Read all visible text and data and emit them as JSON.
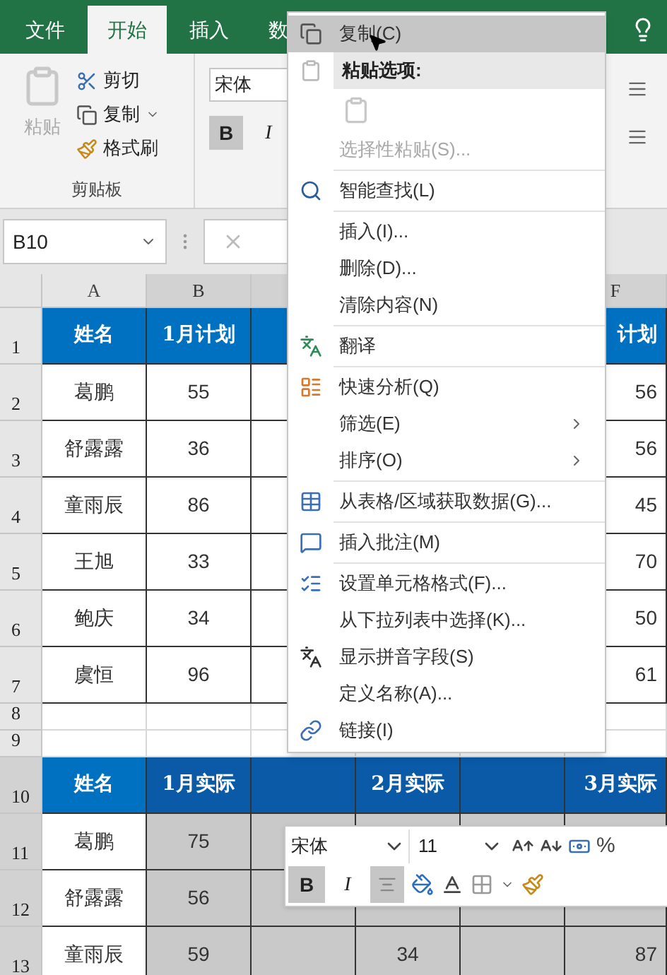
{
  "ribbon_tabs": [
    {
      "label": "文件",
      "selected": false
    },
    {
      "label": "开始",
      "selected": true
    },
    {
      "label": "插入",
      "selected": false
    },
    {
      "label": "数",
      "selected": false
    }
  ],
  "clipboard": {
    "paste": {
      "label": "粘贴",
      "disabled": true
    },
    "actions": [
      {
        "label": "剪切",
        "dropdown": false
      },
      {
        "label": "复制",
        "dropdown": true
      },
      {
        "label": "格式刷",
        "dropdown": false
      }
    ],
    "group_label": "剪贴板"
  },
  "font": {
    "name": "宋体",
    "bold_label": "B",
    "italic_label": "I",
    "bold_pressed": true,
    "italic_pressed": false
  },
  "name_box": "B10",
  "columns": [
    {
      "label": "A",
      "selected": false
    },
    {
      "label": "B",
      "selected": true
    },
    {
      "selected": true
    },
    null,
    null,
    {
      "label": "F",
      "selected": true
    }
  ],
  "rows": [
    {
      "label": "1",
      "kind": "header",
      "selected": false,
      "cells": [
        "姓名",
        "1月计划",
        null,
        null,
        null,
        "计划"
      ]
    },
    {
      "label": "2",
      "kind": "data",
      "selected": false,
      "cells": [
        "葛鹏",
        "55",
        null,
        null,
        null,
        "56"
      ]
    },
    {
      "label": "3",
      "kind": "data",
      "selected": false,
      "cells": [
        "舒露露",
        "36",
        null,
        null,
        null,
        "56"
      ]
    },
    {
      "label": "4",
      "kind": "data",
      "selected": false,
      "cells": [
        "童雨辰",
        "86",
        null,
        null,
        null,
        "45"
      ]
    },
    {
      "label": "5",
      "kind": "data",
      "selected": false,
      "cells": [
        "王旭",
        "33",
        null,
        null,
        null,
        "70"
      ]
    },
    {
      "label": "6",
      "kind": "data",
      "selected": false,
      "cells": [
        "鲍庆",
        "34",
        null,
        null,
        null,
        "50"
      ]
    },
    {
      "label": "7",
      "kind": "data",
      "selected": false,
      "cells": [
        "虞恒",
        "96",
        null,
        null,
        null,
        "61"
      ]
    },
    {
      "label": "8",
      "kind": "empty",
      "selected": false,
      "cells": [
        null,
        null,
        null,
        null,
        null,
        null
      ]
    },
    {
      "label": "9",
      "kind": "empty",
      "selected": false,
      "cells": [
        null,
        null,
        null,
        null,
        null,
        null
      ]
    },
    {
      "label": "10",
      "kind": "header",
      "selected": true,
      "cells": [
        "姓名",
        "1月实际",
        null,
        "2月实际",
        null,
        "3月实际"
      ]
    },
    {
      "label": "11",
      "kind": "data",
      "selected": true,
      "cells": [
        "葛鹏",
        "75",
        null,
        null,
        null,
        null
      ]
    },
    {
      "label": "12",
      "kind": "data",
      "selected": true,
      "cells": [
        "舒露露",
        "56",
        null,
        null,
        null,
        null
      ]
    },
    {
      "label": "13",
      "kind": "data",
      "selected": true,
      "cells": [
        "童雨辰",
        "59",
        null,
        "34",
        null,
        "87"
      ]
    }
  ],
  "context_menu": {
    "items": [
      {
        "kind": "item",
        "label": "复制(C)",
        "highlighted": true,
        "disabled": false,
        "submenu": false
      },
      {
        "kind": "header",
        "label": "粘贴选项:"
      },
      {
        "kind": "paste-option",
        "disabled": true
      },
      {
        "kind": "item",
        "label": "选择性粘贴(S)...",
        "highlighted": false,
        "disabled": true,
        "submenu": false
      },
      {
        "kind": "separator"
      },
      {
        "kind": "item",
        "label": "智能查找(L)",
        "highlighted": false,
        "disabled": false,
        "submenu": false
      },
      {
        "kind": "separator"
      },
      {
        "kind": "item",
        "label": "插入(I)...",
        "highlighted": false,
        "disabled": false,
        "submenu": false
      },
      {
        "kind": "item",
        "label": "删除(D)...",
        "highlighted": false,
        "disabled": false,
        "submenu": false
      },
      {
        "kind": "item",
        "label": "清除内容(N)",
        "highlighted": false,
        "disabled": false,
        "submenu": false
      },
      {
        "kind": "separator"
      },
      {
        "kind": "item",
        "label": "翻译",
        "highlighted": false,
        "disabled": false,
        "submenu": false
      },
      {
        "kind": "separator"
      },
      {
        "kind": "item",
        "label": "快速分析(Q)",
        "highlighted": false,
        "disabled": false,
        "submenu": false
      },
      {
        "kind": "item",
        "label": "筛选(E)",
        "highlighted": false,
        "disabled": false,
        "submenu": true
      },
      {
        "kind": "item",
        "label": "排序(O)",
        "highlighted": false,
        "disabled": false,
        "submenu": true
      },
      {
        "kind": "separator"
      },
      {
        "kind": "item",
        "label": "从表格/区域获取数据(G)...",
        "highlighted": false,
        "disabled": false,
        "submenu": false
      },
      {
        "kind": "separator"
      },
      {
        "kind": "item",
        "label": "插入批注(M)",
        "highlighted": false,
        "disabled": false,
        "submenu": false
      },
      {
        "kind": "separator"
      },
      {
        "kind": "item",
        "label": "设置单元格格式(F)...",
        "highlighted": false,
        "disabled": false,
        "submenu": false
      },
      {
        "kind": "item",
        "label": "从下拉列表中选择(K)...",
        "highlighted": false,
        "disabled": false,
        "submenu": false
      },
      {
        "kind": "item",
        "label": "显示拼音字段(S)",
        "highlighted": false,
        "disabled": false,
        "submenu": false
      },
      {
        "kind": "item",
        "label": "定义名称(A)...",
        "highlighted": false,
        "disabled": false,
        "submenu": false
      },
      {
        "kind": "item",
        "label": "链接(I)",
        "highlighted": false,
        "disabled": false,
        "submenu": false
      }
    ]
  },
  "mini_toolbar": {
    "font": "宋体",
    "size": "11",
    "percent": "%",
    "bold_label": "B",
    "italic_label": "I",
    "bold_pressed": true,
    "italic_pressed": false,
    "center_pressed": true
  }
}
